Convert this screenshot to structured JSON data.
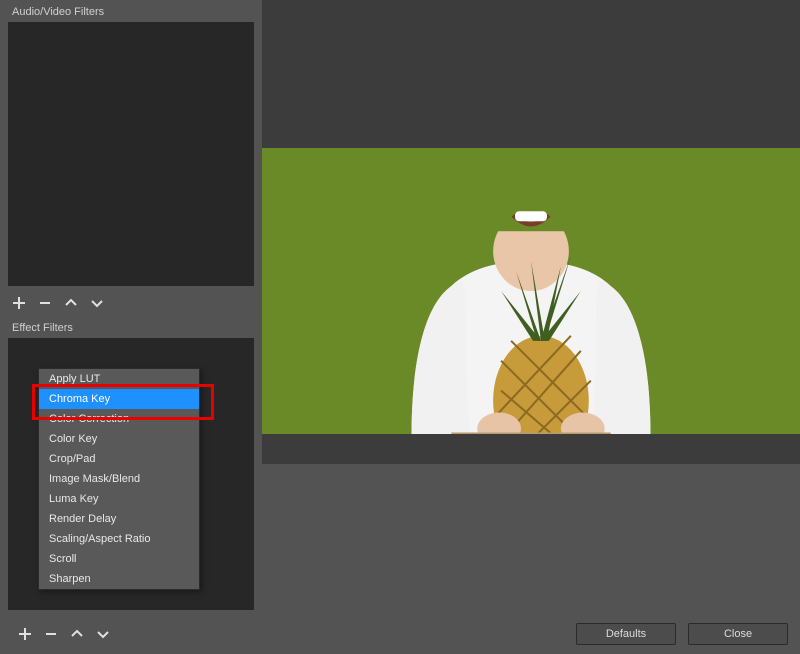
{
  "sections": {
    "audio_video_title": "Audio/Video Filters",
    "effects_title": "Effect Filters"
  },
  "toolbar": {
    "add": "+",
    "remove": "−",
    "up": "˄",
    "down": "˅"
  },
  "effect_menu": {
    "items": [
      {
        "label": "Apply LUT"
      },
      {
        "label": "Chroma Key",
        "selected": true
      },
      {
        "label": "Color Correction"
      },
      {
        "label": "Color Key"
      },
      {
        "label": "Crop/Pad"
      },
      {
        "label": "Image Mask/Blend"
      },
      {
        "label": "Luma Key"
      },
      {
        "label": "Render Delay"
      },
      {
        "label": "Scaling/Aspect Ratio"
      },
      {
        "label": "Scroll"
      },
      {
        "label": "Sharpen"
      }
    ]
  },
  "footer": {
    "defaults": "Defaults",
    "close": "Close"
  }
}
